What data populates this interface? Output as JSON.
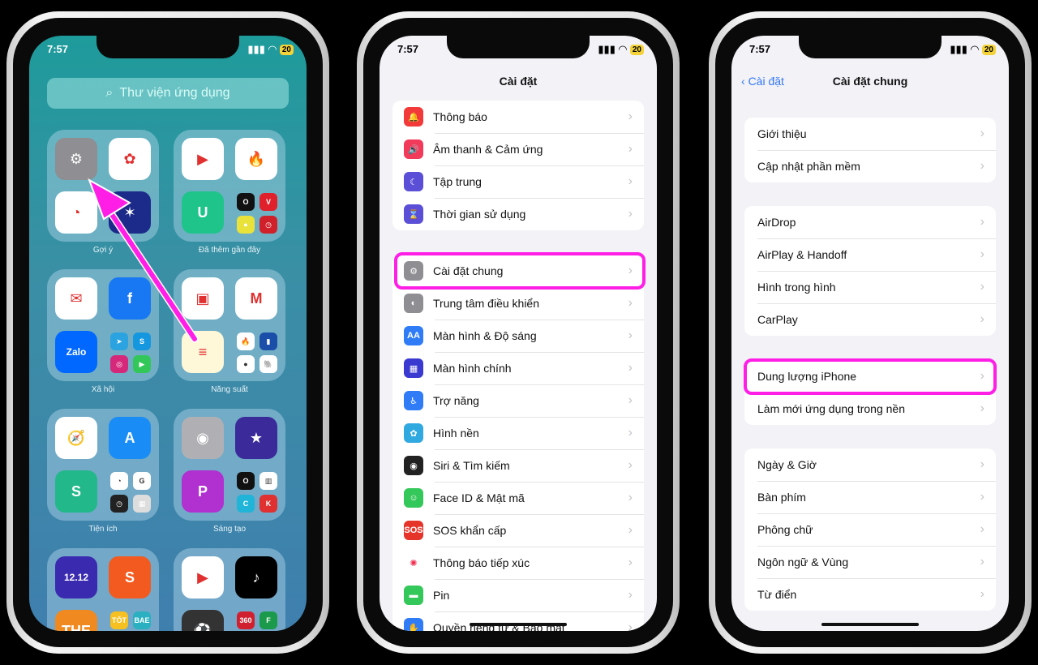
{
  "status": {
    "time": "7:57",
    "battery": "20"
  },
  "phone1": {
    "search_placeholder": "Thư viện ứng dụng",
    "folders": [
      {
        "label": "Gợi ý",
        "apps": [
          {
            "name": "settings",
            "bg": "#8e8e93",
            "t": "⚙"
          },
          {
            "name": "google-photos",
            "bg": "#fff",
            "t": "✿"
          },
          {
            "name": "coc-coc",
            "bg": "#fff",
            "t": "◔"
          },
          {
            "name": "app-star",
            "bg": "#1c2a8a",
            "t": "✶"
          }
        ],
        "minis": []
      },
      {
        "label": "Đã thêm gần đây",
        "apps": [
          {
            "name": "youtube-studio",
            "bg": "#fff",
            "t": "▶"
          },
          {
            "name": "firefox-like",
            "bg": "#fff",
            "t": "🔥"
          },
          {
            "name": "mi-home",
            "bg": "#1ec48a",
            "t": "U"
          }
        ],
        "minis": [
          {
            "bg": "#111",
            "t": "O"
          },
          {
            "bg": "#e0202a",
            "t": "V"
          },
          {
            "bg": "#e8e23a",
            "t": "●"
          },
          {
            "bg": "#d0202a",
            "t": "◷"
          }
        ]
      },
      {
        "label": "Xã hội",
        "apps": [
          {
            "name": "messenger",
            "bg": "#fff",
            "t": "✉"
          },
          {
            "name": "facebook",
            "bg": "#1877f2",
            "t": "f"
          },
          {
            "name": "zalo",
            "bg": "#0068ff",
            "t": "Zalo"
          }
        ],
        "minis": [
          {
            "bg": "#2aa3e0",
            "t": "➤"
          },
          {
            "bg": "#1597e0",
            "t": "S"
          },
          {
            "bg": "#d6287b",
            "t": "◎"
          },
          {
            "bg": "#33c759",
            "t": "▶"
          }
        ]
      },
      {
        "label": "Năng suất",
        "apps": [
          {
            "name": "google-chat",
            "bg": "#fff",
            "t": "▣"
          },
          {
            "name": "gmail",
            "bg": "#fff",
            "t": "M"
          },
          {
            "name": "notes",
            "bg": "#fff8d8",
            "t": "≡"
          }
        ],
        "minis": [
          {
            "bg": "#fff",
            "t": "🔥"
          },
          {
            "bg": "#1a4ea8",
            "t": "▮"
          },
          {
            "bg": "#fff",
            "t": "●"
          },
          {
            "bg": "#fff",
            "t": "🐘"
          }
        ]
      },
      {
        "label": "Tiện ích",
        "apps": [
          {
            "name": "safari",
            "bg": "#fff",
            "t": "🧭"
          },
          {
            "name": "app-store",
            "bg": "#1a8cf5",
            "t": "A"
          },
          {
            "name": "app-s",
            "bg": "#22b889",
            "t": "S"
          }
        ],
        "minis": [
          {
            "bg": "#fff",
            "t": "◔"
          },
          {
            "bg": "#fff",
            "t": "G"
          },
          {
            "bg": "#222",
            "t": "◷"
          },
          {
            "bg": "#ddd",
            "t": "▦"
          }
        ]
      },
      {
        "label": "Sáng tạo",
        "apps": [
          {
            "name": "camera",
            "bg": "#b0b0b4",
            "t": "◉"
          },
          {
            "name": "imovie",
            "bg": "#3a2a9a",
            "t": "★"
          },
          {
            "name": "picsart",
            "bg": "#b030d0",
            "t": "P"
          }
        ],
        "minis": [
          {
            "bg": "#111",
            "t": "O"
          },
          {
            "bg": "#fff",
            "t": "▥"
          },
          {
            "bg": "#1fb4d8",
            "t": "C"
          },
          {
            "bg": "#e03030",
            "t": "K"
          }
        ]
      },
      {
        "label": "",
        "apps": [
          {
            "name": "lazada",
            "bg": "#3a2ab0",
            "t": "12.12"
          },
          {
            "name": "shopee",
            "bg": "#f25a20",
            "t": "S"
          },
          {
            "name": "the-coffee-house",
            "bg": "#f08a20",
            "t": "THE"
          }
        ],
        "minis": [
          {
            "bg": "#f5c020",
            "t": "TỐT"
          },
          {
            "bg": "#2ab0c0",
            "t": "BAE"
          }
        ]
      },
      {
        "label": "",
        "apps": [
          {
            "name": "youtube",
            "bg": "#fff",
            "t": "▶"
          },
          {
            "name": "tiktok",
            "bg": "#000",
            "t": "♪"
          },
          {
            "name": "app-ball",
            "bg": "#333",
            "t": "⚽"
          }
        ],
        "minis": [
          {
            "bg": "#d02030",
            "t": "360"
          },
          {
            "bg": "#1a9a4a",
            "t": "F"
          }
        ]
      }
    ]
  },
  "phone2": {
    "title": "Cài đặt",
    "groups": [
      [
        {
          "label": "Thông báo",
          "icon": "bell-icon",
          "color": "#f23a3a",
          "g": "🔔"
        },
        {
          "label": "Âm thanh & Cảm ứng",
          "icon": "speaker-icon",
          "color": "#f23a5a",
          "g": "🔊"
        },
        {
          "label": "Tập trung",
          "icon": "moon-icon",
          "color": "#5a4fd6",
          "g": "☾"
        },
        {
          "label": "Thời gian sử dụng",
          "icon": "hourglass-icon",
          "color": "#5a4fd6",
          "g": "⌛"
        }
      ],
      [
        {
          "label": "Cài đặt chung",
          "icon": "gear-icon",
          "color": "#8e8e93",
          "g": "⚙"
        },
        {
          "label": "Trung tâm điều khiển",
          "icon": "toggles-icon",
          "color": "#8e8e93",
          "g": "◐"
        },
        {
          "label": "Màn hình & Độ sáng",
          "icon": "text-size-icon",
          "color": "#2f7cf6",
          "g": "AA"
        },
        {
          "label": "Màn hình chính",
          "icon": "home-grid-icon",
          "color": "#3a3ad0",
          "g": "▦"
        },
        {
          "label": "Trợ năng",
          "icon": "accessibility-icon",
          "color": "#2f7cf6",
          "g": "♿"
        },
        {
          "label": "Hình nền",
          "icon": "wallpaper-icon",
          "color": "#30a8e0",
          "g": "✿"
        },
        {
          "label": "Siri & Tìm kiếm",
          "icon": "siri-icon",
          "color": "#222",
          "g": "◉"
        },
        {
          "label": "Face ID & Mật mã",
          "icon": "face-id-icon",
          "color": "#34c759",
          "g": "☺"
        },
        {
          "label": "SOS khẩn cấp",
          "icon": "sos-icon",
          "color": "#e5352b",
          "g": "SOS"
        },
        {
          "label": "Thông báo tiếp xúc",
          "icon": "exposure-icon",
          "color": "#fff",
          "g": "✺"
        },
        {
          "label": "Pin",
          "icon": "battery-icon",
          "color": "#34c759",
          "g": "▬"
        },
        {
          "label": "Quyền riêng tư & Bảo mật",
          "icon": "privacy-icon",
          "color": "#2f7cf6",
          "g": "✋"
        }
      ]
    ]
  },
  "phone3": {
    "back_label": "Cài đặt",
    "title": "Cài đặt chung",
    "groups": [
      [
        {
          "label": "Giới thiệu"
        },
        {
          "label": "Cập nhật phần mềm"
        }
      ],
      [
        {
          "label": "AirDrop"
        },
        {
          "label": "AirPlay & Handoff"
        },
        {
          "label": "Hình trong hình"
        },
        {
          "label": "CarPlay"
        }
      ],
      [
        {
          "label": "Dung lượng iPhone"
        },
        {
          "label": "Làm mới ứng dụng trong nền"
        }
      ],
      [
        {
          "label": "Ngày & Giờ"
        },
        {
          "label": "Bàn phím"
        },
        {
          "label": "Phông chữ"
        },
        {
          "label": "Ngôn ngữ & Vùng"
        },
        {
          "label": "Từ điển"
        }
      ]
    ]
  },
  "colors": {
    "highlight": "#ff1ee6",
    "ios_blue": "#3478f6"
  }
}
